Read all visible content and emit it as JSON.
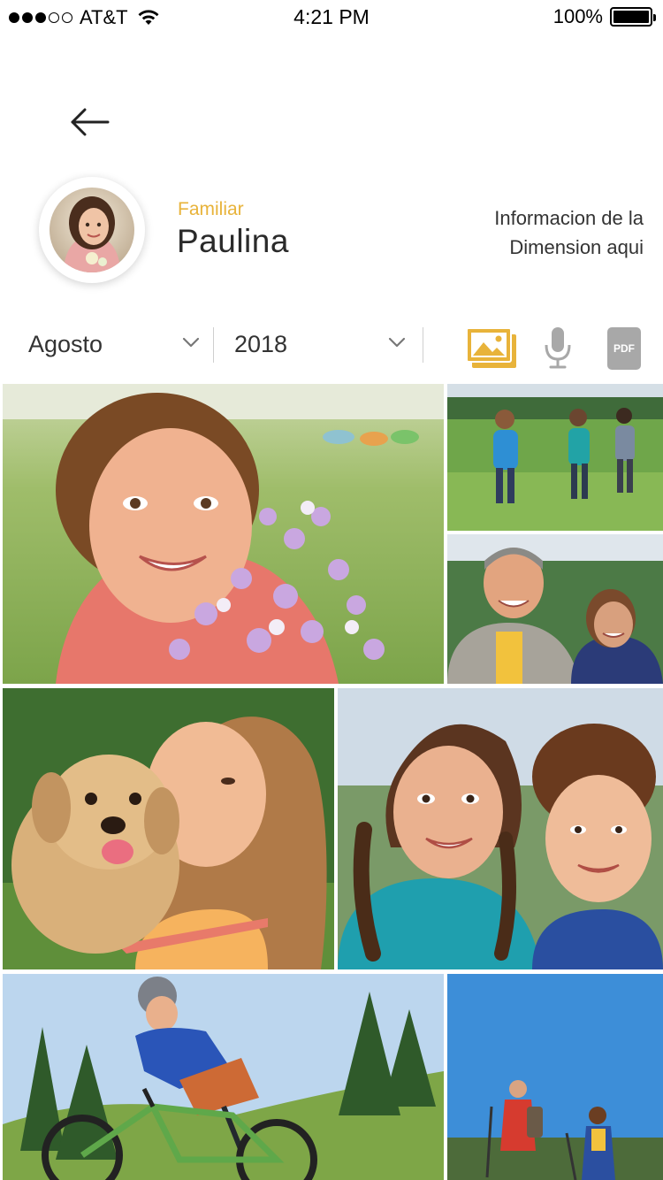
{
  "status_bar": {
    "carrier": "AT&T",
    "time": "4:21 PM",
    "battery": "100%",
    "signal_bars": 3,
    "signal_total": 5
  },
  "header": {
    "back_icon": "arrow-left-icon"
  },
  "profile": {
    "role": "Familiar",
    "name": "Paulina",
    "dimension_info_line1": "Informacion de la",
    "dimension_info_line2": "Dimension aqui"
  },
  "filters": {
    "month": "Agosto",
    "year": "2018"
  },
  "media_types": {
    "gallery_icon": "image-gallery-icon",
    "mic_icon": "microphone-icon",
    "pdf_label": "PDF",
    "active": "gallery"
  },
  "colors": {
    "accent": "#e8b33a",
    "inactive_icon": "#a8a8a8"
  },
  "photos": [
    "photo-girl-with-flowers",
    "photo-kids-running-in-field",
    "photo-couple-smiling",
    "photo-girl-with-puppy",
    "photo-girl-and-boy-smiling",
    "photo-boy-riding-bike",
    "photo-hikers-on-trail"
  ]
}
